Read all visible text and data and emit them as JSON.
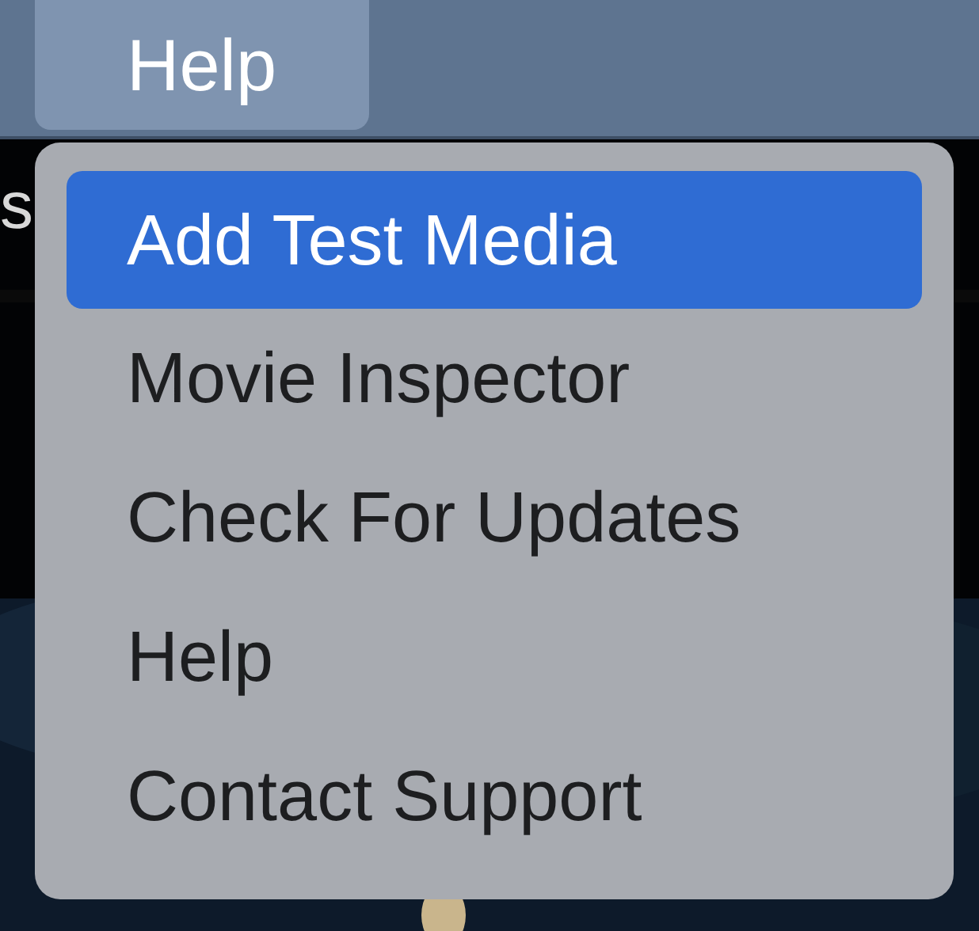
{
  "menu_bar": {
    "items": [
      {
        "label": "Help",
        "selected": true
      }
    ]
  },
  "window_title_fragment": "s",
  "menu": {
    "items": [
      {
        "label": "Add Test Media",
        "selected": true
      },
      {
        "label": "Movie Inspector",
        "selected": false
      },
      {
        "label": "Check For Updates",
        "selected": false
      },
      {
        "label": "Help",
        "selected": false
      },
      {
        "label": "Contact Support",
        "selected": false
      }
    ]
  }
}
